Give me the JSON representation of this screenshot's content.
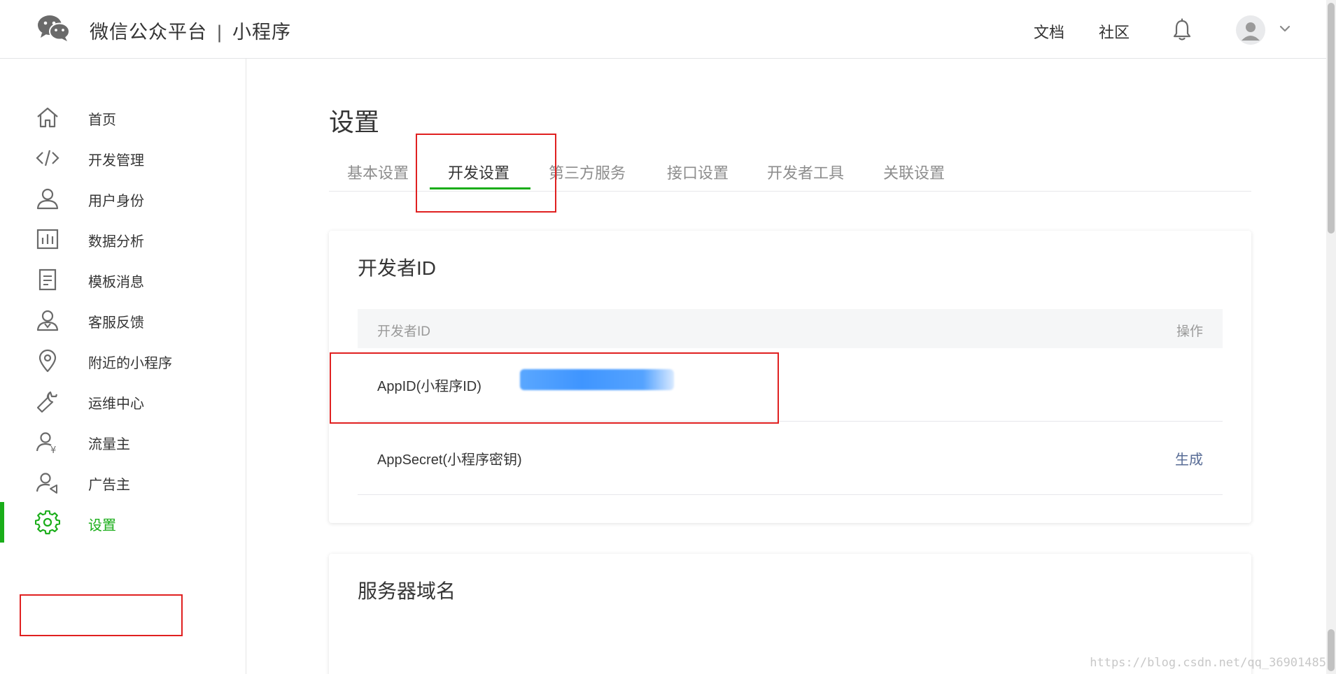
{
  "header": {
    "brand_name": "微信公众平台",
    "separator": "|",
    "product_name": "小程序",
    "links": [
      "文档",
      "社区"
    ]
  },
  "sidebar": {
    "items": [
      {
        "label": "首页",
        "icon": "home-icon"
      },
      {
        "label": "开发管理",
        "icon": "code-icon"
      },
      {
        "label": "用户身份",
        "icon": "user-icon"
      },
      {
        "label": "数据分析",
        "icon": "chart-icon"
      },
      {
        "label": "模板消息",
        "icon": "document-icon"
      },
      {
        "label": "客服反馈",
        "icon": "support-user-icon"
      },
      {
        "label": "附近的小程序",
        "icon": "location-pin-icon"
      },
      {
        "label": "运维中心",
        "icon": "wrench-icon"
      },
      {
        "label": "流量主",
        "icon": "user-yen-icon"
      },
      {
        "label": "广告主",
        "icon": "user-megaphone-icon"
      },
      {
        "label": "设置",
        "icon": "gear-icon",
        "active": true
      }
    ]
  },
  "main": {
    "title": "设置",
    "tabs": [
      {
        "label": "基本设置"
      },
      {
        "label": "开发设置",
        "active": true
      },
      {
        "label": "第三方服务"
      },
      {
        "label": "接口设置"
      },
      {
        "label": "开发者工具"
      },
      {
        "label": "关联设置"
      }
    ],
    "dev_id_card": {
      "title": "开发者ID",
      "columns": [
        "开发者ID",
        "操作"
      ],
      "rows": [
        {
          "key": "AppID(小程序ID)",
          "value_masked": true,
          "action": ""
        },
        {
          "key": "AppSecret(小程序密钥)",
          "action": "生成"
        }
      ]
    },
    "server_card": {
      "title": "服务器域名"
    }
  },
  "watermark": "https://blog.csdn.net/qq_36901485",
  "colors": {
    "accent": "#1aad19",
    "link": "#576b95",
    "highlight": "#e02020"
  }
}
